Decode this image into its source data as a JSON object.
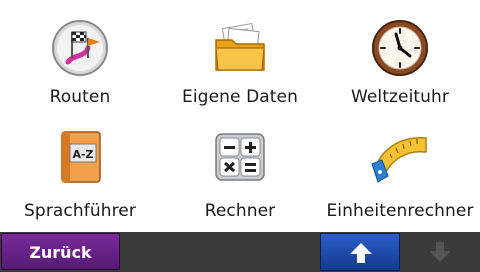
{
  "menu": {
    "items": [
      {
        "label": "Routen",
        "icon": "routes-flag-icon"
      },
      {
        "label": "Eigene Daten",
        "icon": "folder-icon"
      },
      {
        "label": "Weltzeituhr",
        "icon": "clock-icon"
      },
      {
        "label": "Sprachführer",
        "icon": "phrasebook-icon"
      },
      {
        "label": "Rechner",
        "icon": "calculator-icon"
      },
      {
        "label": "Einheitenrechner",
        "icon": "tape-measure-icon"
      }
    ]
  },
  "bottom_bar": {
    "back_label": "Zurück",
    "scroll_up_icon": "arrow-up-icon",
    "scroll_down_icon": "arrow-down-icon"
  },
  "colors": {
    "back_button": "#6a2388",
    "up_button": "#1f4db0",
    "bar": "#3a3a3a"
  }
}
